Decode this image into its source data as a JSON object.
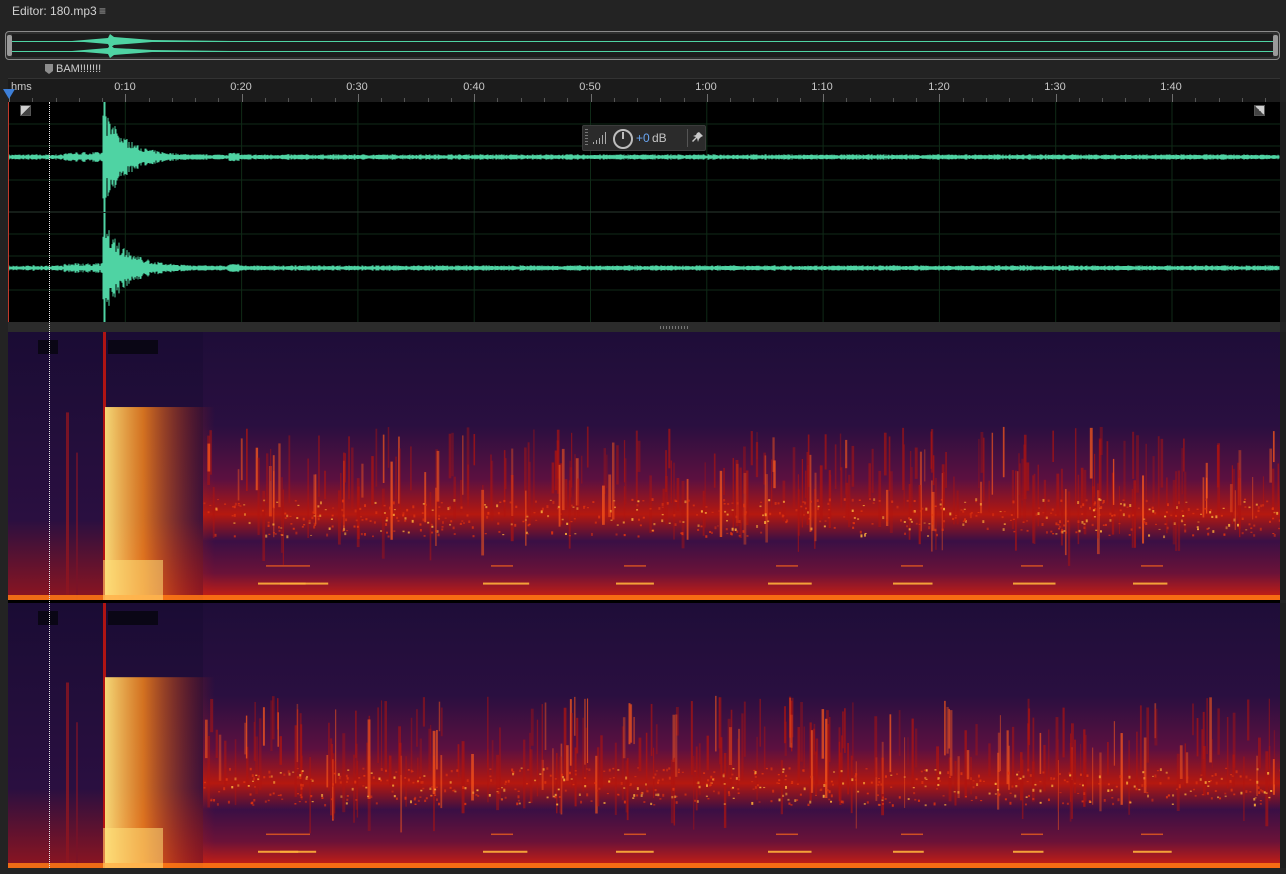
{
  "editor": {
    "title": "Editor: 180.mp3",
    "menu_glyph": "≡"
  },
  "marker": {
    "label": "BAM!!!!!!!",
    "icon": "marker-flag-icon"
  },
  "ruler": {
    "unit": "hms",
    "ticks": [
      "0:10",
      "0:20",
      "0:30",
      "0:40",
      "0:50",
      "1:00",
      "1:10",
      "1:20",
      "1:30",
      "1:40"
    ]
  },
  "hud": {
    "gain": "+0",
    "unit": "dB",
    "pin_glyph": "📌"
  },
  "colors": {
    "waveform": "#4fd3a3",
    "spectral_low": "#1c0d35",
    "spectral_mid": "#c0150f",
    "spectral_high": "#ffe27a",
    "playhead": "#3d7fd8"
  }
}
